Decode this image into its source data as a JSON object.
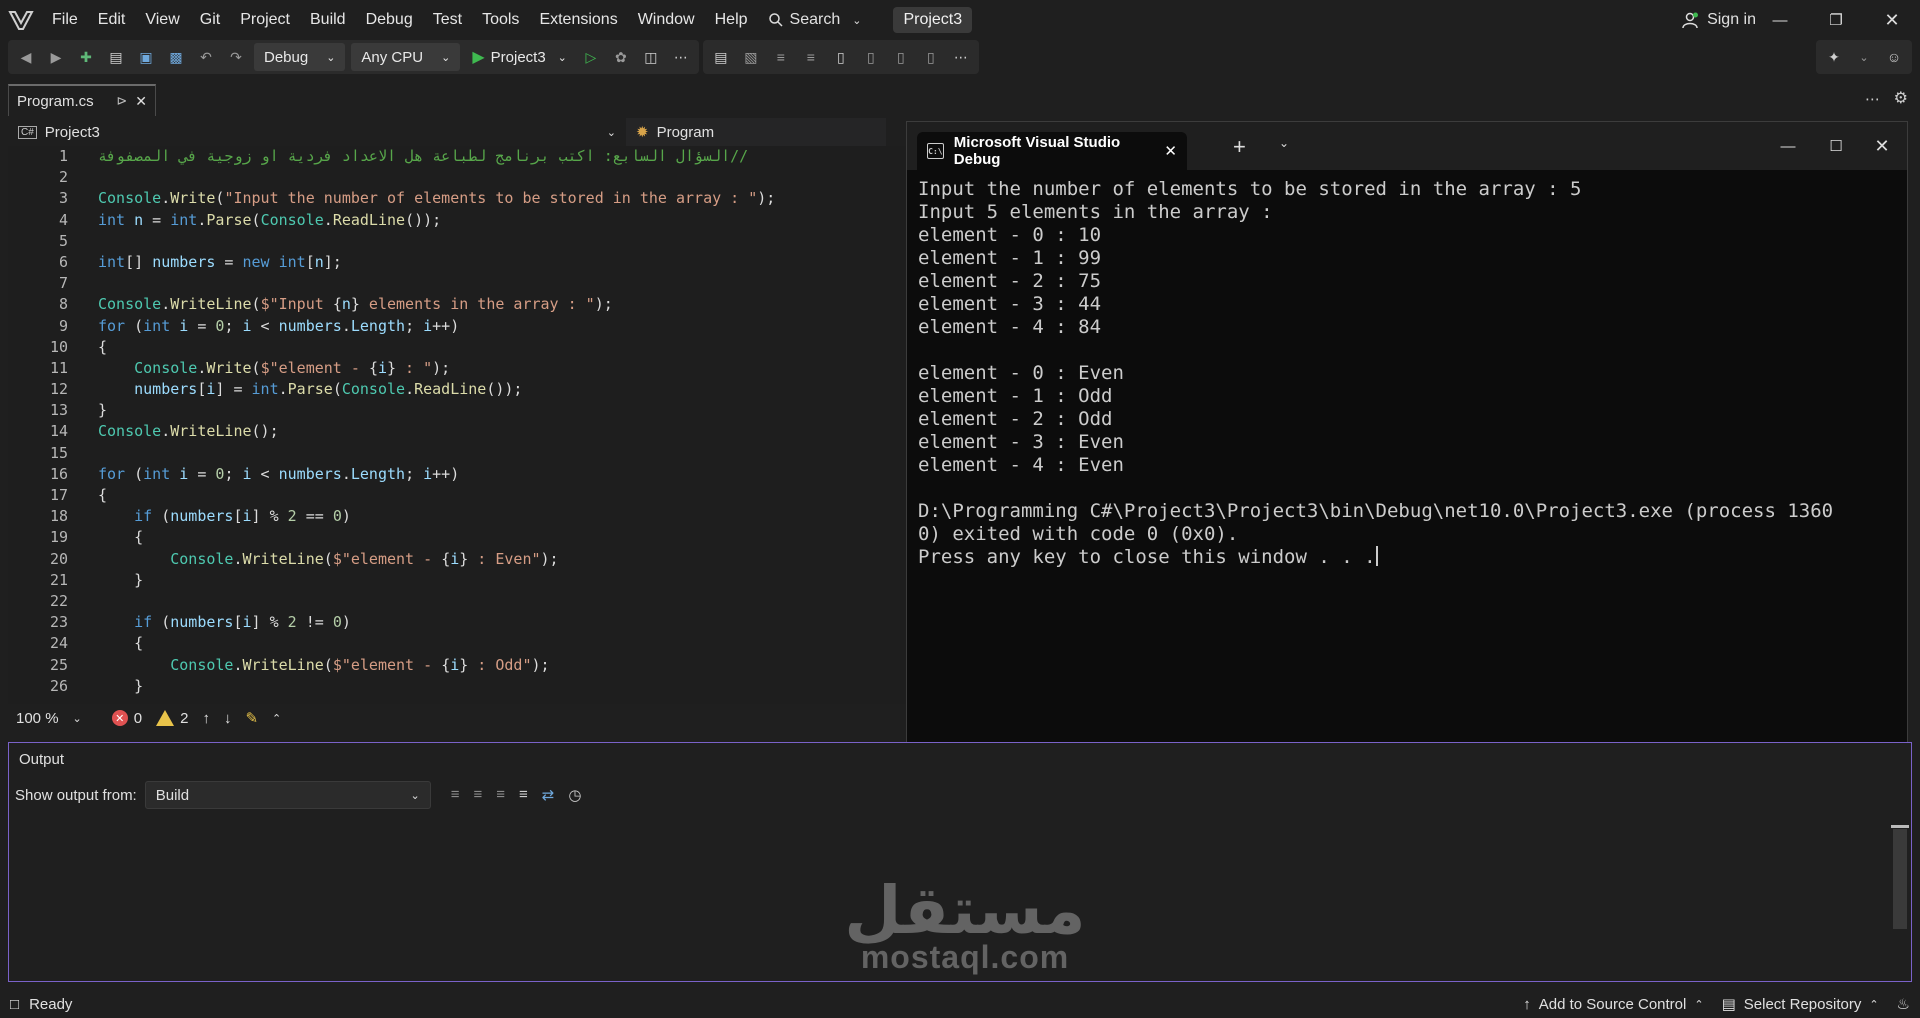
{
  "menubar": {
    "items": [
      "File",
      "Edit",
      "View",
      "Git",
      "Project",
      "Build",
      "Debug",
      "Test",
      "Tools",
      "Extensions",
      "Window",
      "Help"
    ],
    "search_label": "Search",
    "project_title": "Project3",
    "signin_label": "Sign in"
  },
  "toolbar": {
    "config": "Debug",
    "platform": "Any CPU",
    "run_target": "Project3"
  },
  "doc_tab": {
    "label": "Program.cs"
  },
  "navbar": {
    "project": "Project3",
    "member": "Program"
  },
  "editor": {
    "line_numbers": [
      "1",
      "2",
      "3",
      "4",
      "5",
      "6",
      "7",
      "8",
      "9",
      "10",
      "11",
      "12",
      "13",
      "14",
      "15",
      "16",
      "17",
      "18",
      "19",
      "20",
      "21",
      "22",
      "23",
      "24",
      "25",
      "26"
    ],
    "comment_line": "//السؤال السابع: اكتب برنامج لطباعة هل الاعداد فردية او زوجية في المصفوفة"
  },
  "editor_status": {
    "zoom": "100 %",
    "errors": "0",
    "warnings": "2"
  },
  "console": {
    "title": "Microsoft Visual Studio Debug",
    "lines": [
      "Input the number of elements to be stored in the array : 5",
      "Input 5 elements in the array :",
      "element - 0 : 10",
      "element - 1 : 99",
      "element - 2 : 75",
      "element - 3 : 44",
      "element - 4 : 84",
      "",
      "element - 0 : Even",
      "element - 1 : Odd",
      "element - 2 : Odd",
      "element - 3 : Even",
      "element - 4 : Even",
      "",
      "D:\\Programming C#\\Project3\\Project3\\bin\\Debug\\net10.0\\Project3.exe (process 1360",
      "0) exited with code 0 (0x0).",
      "Press any key to close this window . . ."
    ]
  },
  "output": {
    "title": "Output",
    "show_from_label": "Show output from:",
    "source": "Build"
  },
  "watermark": {
    "arabic": "مستقل",
    "latin": "mostaql.com"
  },
  "statusbar": {
    "ready": "Ready",
    "source_control": "Add to Source Control",
    "repository": "Select Repository"
  }
}
